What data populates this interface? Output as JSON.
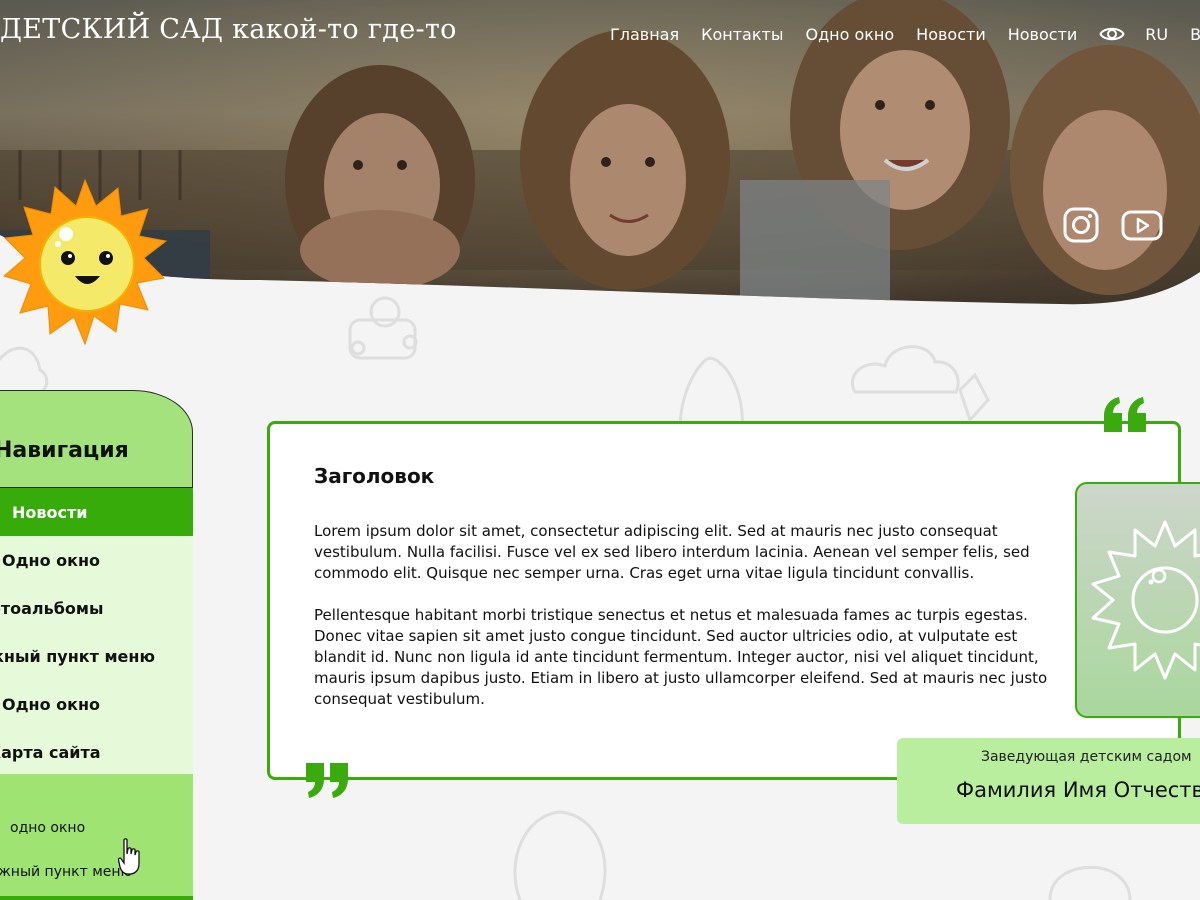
{
  "header": {
    "site_title": "ДЕТСКИЙ САД какой-то где-то",
    "nav": [
      {
        "label": "Главная"
      },
      {
        "label": "Контакты"
      },
      {
        "label": "Одно окно"
      },
      {
        "label": "Новости"
      },
      {
        "label": "Новости"
      }
    ],
    "accessibility_icon": "eye-icon",
    "language": "RU",
    "overflow_text": "В",
    "social": [
      {
        "icon": "instagram-icon"
      },
      {
        "icon": "youtube-icon"
      }
    ]
  },
  "sidebar": {
    "title": "Навигация",
    "items": [
      {
        "label": "Новости",
        "state": "active"
      },
      {
        "label": "Одно окно",
        "state": "normal"
      },
      {
        "label": "Фотоальбомы",
        "state": "normal"
      },
      {
        "label": "Важный пункт меню",
        "state": "normal"
      },
      {
        "label": "Одно окно",
        "state": "normal"
      },
      {
        "label": "Карта сайта",
        "state": "normal"
      }
    ],
    "sub_items": [
      {
        "label": "одно окно"
      },
      {
        "label": "Важный пункт меню"
      }
    ]
  },
  "content": {
    "title": "Заголовок",
    "paragraphs": [
      "Lorem ipsum dolor sit amet, consectetur adipiscing elit. Sed at mauris nec justo consequat vestibulum. Nulla facilisi. Fusce vel ex sed libero interdum lacinia. Aenean vel semper felis, sed commodo elit. Quisque nec semper urna. Cras eget urna vitae ligula tincidunt convallis.",
      "Pellentesque habitant morbi tristique senectus et netus et malesuada fames ac turpis egestas. Donec vitae sapien sit amet justo congue tincidunt. Sed auctor ultricies odio, at vulputate est blandit id. Nunc non ligula id ante tincidunt fermentum. Integer auctor, nisi vel aliquet tincidunt, mauris ipsum dapibus justo. Etiam in libero at justo ullamcorper eleifend. Sed at mauris nec justo consequat vestibulum."
    ]
  },
  "director": {
    "position": "Заведующая детским садом",
    "name": "Фамилия Имя Отчество"
  },
  "colors": {
    "primary_green": "#36ab0a",
    "light_green": "#a3e27d",
    "pale_green": "#e6f9d8",
    "sun_orange": "#ff9b0f",
    "sun_face": "#f5e96a",
    "page_bg": "#f4f4f4"
  }
}
